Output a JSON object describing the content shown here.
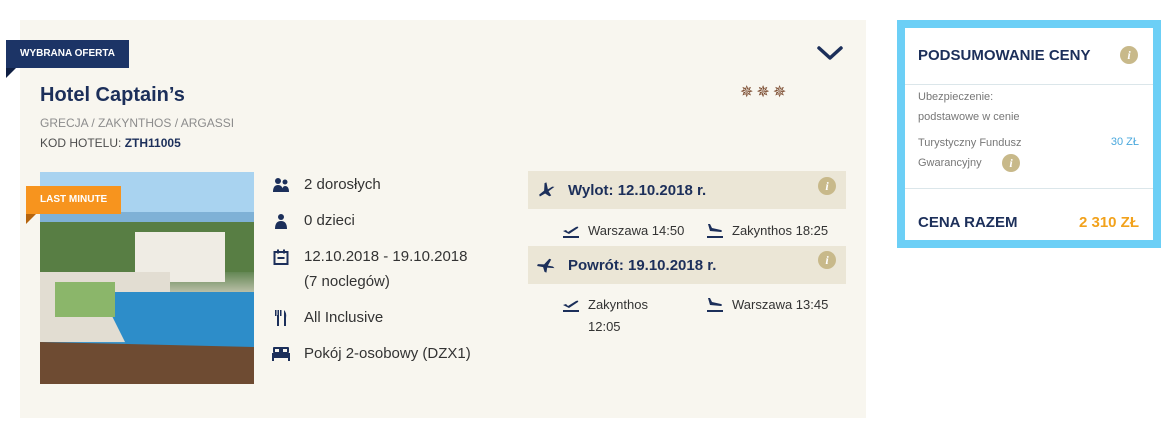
{
  "offer": {
    "ribbon": "WYBRANA OFERTA",
    "hotel_name": "Hotel Captain’s",
    "stars": "✵✵✵",
    "location": "GRECJA / ZAKYNTHOS / ARGASSI",
    "code_label": "KOD HOTELU:",
    "code_value": "ZTH11005",
    "badge": "LAST MINUTE",
    "expand_icon": "chevron-down-icon"
  },
  "details": {
    "adults": "2 dorosłych",
    "children": "0 dzieci",
    "dates": "12.10.2018 - 19.10.2018",
    "nights": "(7 noclegów)",
    "board": "All Inclusive",
    "room": "Pokój 2-osobowy (DZX1)"
  },
  "flights": {
    "outbound": {
      "title": "Wylot: 12.10.2018 r.",
      "from": "Warszawa 14:50",
      "to": "Zakynthos 18:25"
    },
    "return": {
      "title": "Powrót: 19.10.2018 r.",
      "from_city": "Zakynthos",
      "from_time": "12:05",
      "to": "Warszawa 13:45"
    },
    "info_glyph": "i"
  },
  "summary": {
    "title": "PODSUMOWANIE CENY",
    "insurance_label": "Ubezpieczenie:",
    "insurance_value": "podstawowe w cenie",
    "fund_label_1": "Turystyczny Fundusz",
    "fund_label_2": "Gwarancyjny",
    "fund_value": "30 ZŁ",
    "total_label": "CENA RAZEM",
    "total_value": "2 310 ZŁ"
  },
  "colors": {
    "navy": "#1c3466",
    "orange": "#f7941e",
    "summary_border": "#6ccff6",
    "info": "#c8b98a",
    "price": "#f2a21c"
  }
}
